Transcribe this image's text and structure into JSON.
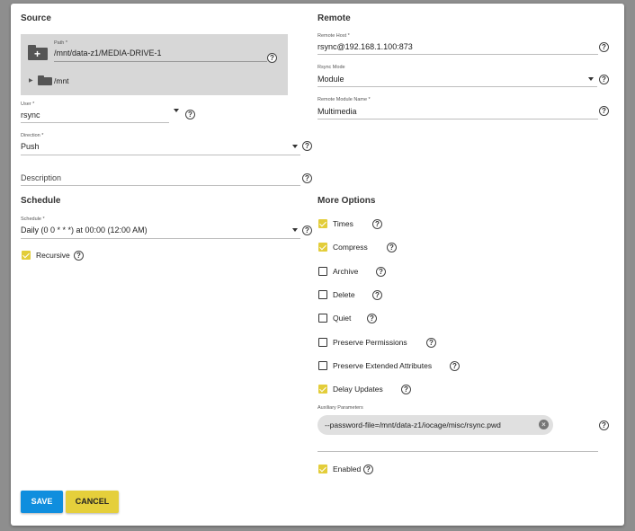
{
  "source": {
    "title": "Source",
    "path_label": "Path *",
    "path_value": "/mnt/data-z1/MEDIA-DRIVE-1",
    "tree_item": "/mnt",
    "user_label": "User *",
    "user_value": "rsync",
    "direction_label": "Direction *",
    "direction_value": "Push",
    "description_placeholder": "Description"
  },
  "remote": {
    "title": "Remote",
    "host_label": "Remote Host *",
    "host_value": "rsync@192.168.1.100:873",
    "mode_label": "Rsync Mode",
    "mode_value": "Module",
    "module_label": "Remote Module Name *",
    "module_value": "Multimedia"
  },
  "schedule": {
    "title": "Schedule",
    "label": "Schedule *",
    "value": "Daily (0 0 * * *) at 00:00 (12:00 AM)",
    "recursive_label": "Recursive",
    "recursive_checked": true
  },
  "more_options": {
    "title": "More Options",
    "options": [
      {
        "label": "Times",
        "checked": true
      },
      {
        "label": "Compress",
        "checked": true
      },
      {
        "label": "Archive",
        "checked": false
      },
      {
        "label": "Delete",
        "checked": false
      },
      {
        "label": "Quiet",
        "checked": false
      },
      {
        "label": "Preserve Permissions",
        "checked": false
      },
      {
        "label": "Preserve Extended Attributes",
        "checked": false
      },
      {
        "label": "Delay Updates",
        "checked": true
      }
    ],
    "aux_label": "Auxiliary Parameters",
    "aux_chip": "--password-file=/mnt/data-z1/iocage/misc/rsync.pwd",
    "enabled_label": "Enabled",
    "enabled_checked": true
  },
  "actions": {
    "save": "SAVE",
    "cancel": "CANCEL"
  },
  "colors": {
    "accent_yellow": "#e3cd3a",
    "save_blue": "#0f8ede"
  },
  "icons": {
    "help": "?",
    "chip_remove": "×",
    "tree_expand": "▶"
  }
}
